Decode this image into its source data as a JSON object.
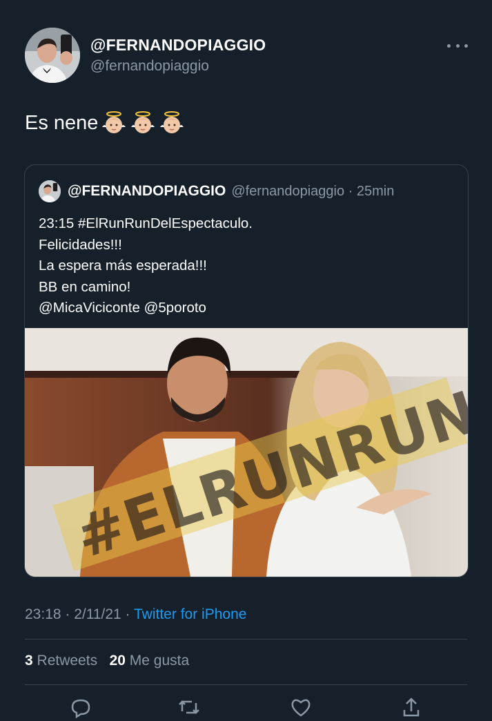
{
  "author": {
    "display_name": "@FERNANDOPIAGGIO",
    "handle": "@fernandopiaggio"
  },
  "tweet": {
    "text": "Es nene",
    "emojis": [
      "baby-angel-emoji",
      "baby-angel-emoji",
      "baby-angel-emoji"
    ]
  },
  "quoted": {
    "display_name": "@FERNANDOPIAGGIO",
    "handle_time": "@fernandopiaggio · 25min",
    "lines": [
      "23:15 #ElRunRunDelEspectaculo.",
      "Felicidades!!!",
      "La espera más esperada!!!",
      "BB en camino!",
      "@MicaViciconte @5poroto"
    ],
    "image": {
      "watermark": "#ELRUNRUN"
    }
  },
  "meta": {
    "time_date": "23:18 · 2/11/21 · ",
    "source": "Twitter for iPhone"
  },
  "stats": {
    "retweets_count": "3",
    "retweets_label": "Retweets",
    "likes_count": "20",
    "likes_label": "Me gusta"
  },
  "colors": {
    "background": "#15202b",
    "link": "#1d9bf0",
    "secondary_text": "#8b98a5",
    "border": "#38444d"
  },
  "icons": [
    "more-icon",
    "reply-icon",
    "retweet-icon",
    "like-icon",
    "share-icon"
  ]
}
